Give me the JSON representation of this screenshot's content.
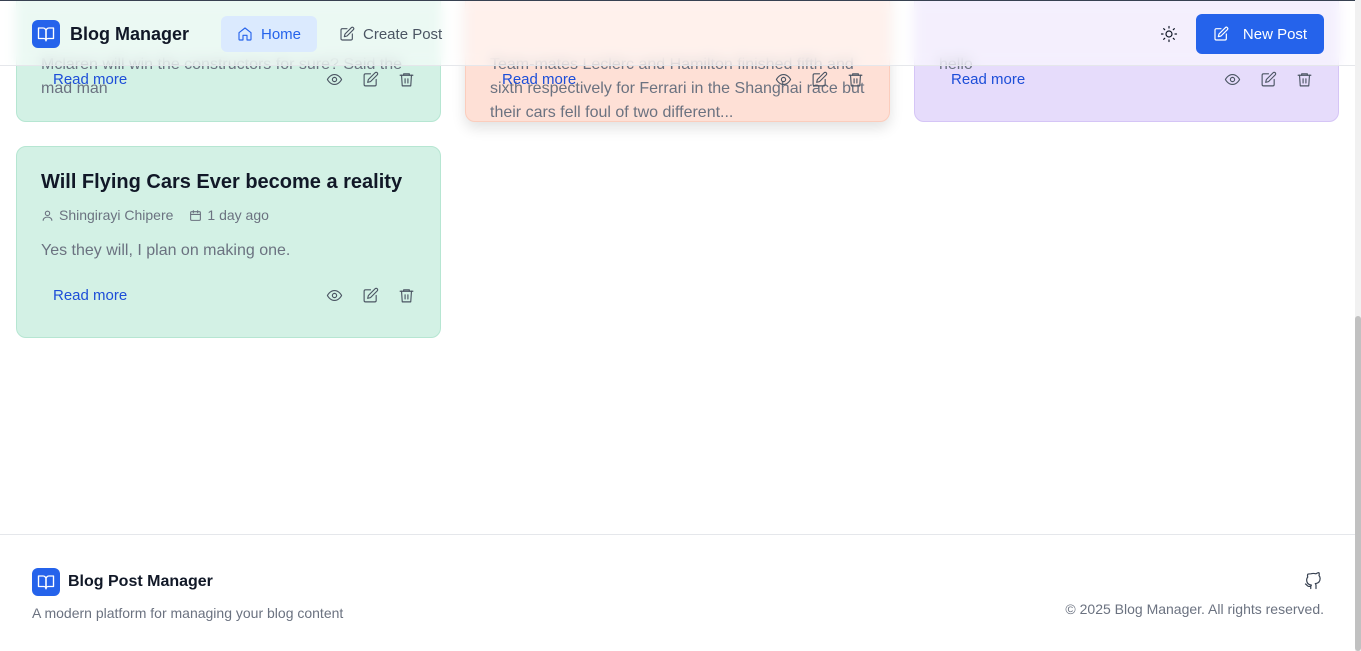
{
  "header": {
    "app_title": "Blog Manager",
    "nav": [
      {
        "label": "Home",
        "icon": "home-icon",
        "active": true
      },
      {
        "label": "Create Post",
        "icon": "edit-icon",
        "active": false
      }
    ],
    "new_post_label": "New Post"
  },
  "cards": [
    {
      "color": "#d3f1e5",
      "excerpt": "Mclaren will win the constructors for sure? Said the mad man",
      "read_more": "Read more"
    },
    {
      "color": "#fee0d6",
      "excerpt": "Team-mates Leclerc and Hamilton finished fifth and sixth respectively for Ferrari in the Shanghai race but their cars fell foul of two different...",
      "read_more": "Read more"
    },
    {
      "color": "#e6dcfb",
      "excerpt": "hello",
      "read_more": "Read more"
    },
    {
      "color": "#d3f1e5",
      "title": "Will Flying Cars Ever become a reality",
      "author": "Shingirayi Chipere",
      "date": "1 day ago",
      "excerpt": "Yes they will, I plan on making one.",
      "read_more": "Read more"
    }
  ],
  "footer": {
    "title": "Blog Post Manager",
    "tagline": "A modern platform for managing your blog content",
    "copyright": "© 2025 Blog Manager. All rights reserved."
  },
  "colors": {
    "accent": "#2563eb",
    "accent_light": "#dbeafe",
    "link": "#1d4ed8"
  }
}
